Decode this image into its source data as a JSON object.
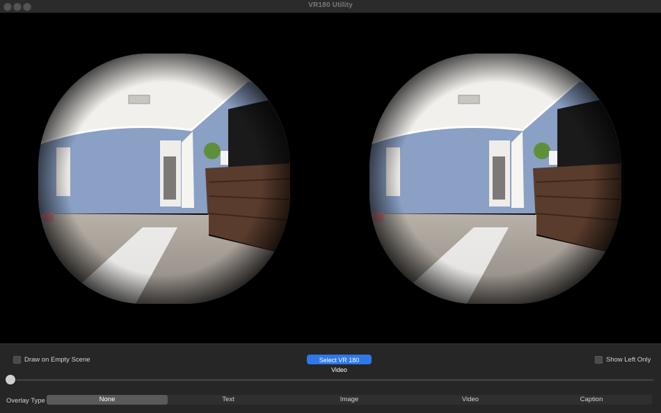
{
  "window": {
    "title": "VR180 Utility"
  },
  "controls": {
    "draw_on_empty_scene_label": "Draw on Empty Scene",
    "draw_on_empty_scene_checked": false,
    "select_video_label": "Select VR 180 Video",
    "show_left_only_label": "Show Left Only",
    "show_left_only_checked": false,
    "timeline_progress": 0.0,
    "overlay_type_label": "Overlay Type",
    "overlay_options": [
      "None",
      "Text",
      "Image",
      "Video",
      "Caption"
    ],
    "overlay_selected": "None"
  },
  "colors": {
    "accent": "#2f78e8",
    "wall": "#8aa0c4",
    "floor": "#a9a29a",
    "dresser": "#5a3c2c"
  }
}
